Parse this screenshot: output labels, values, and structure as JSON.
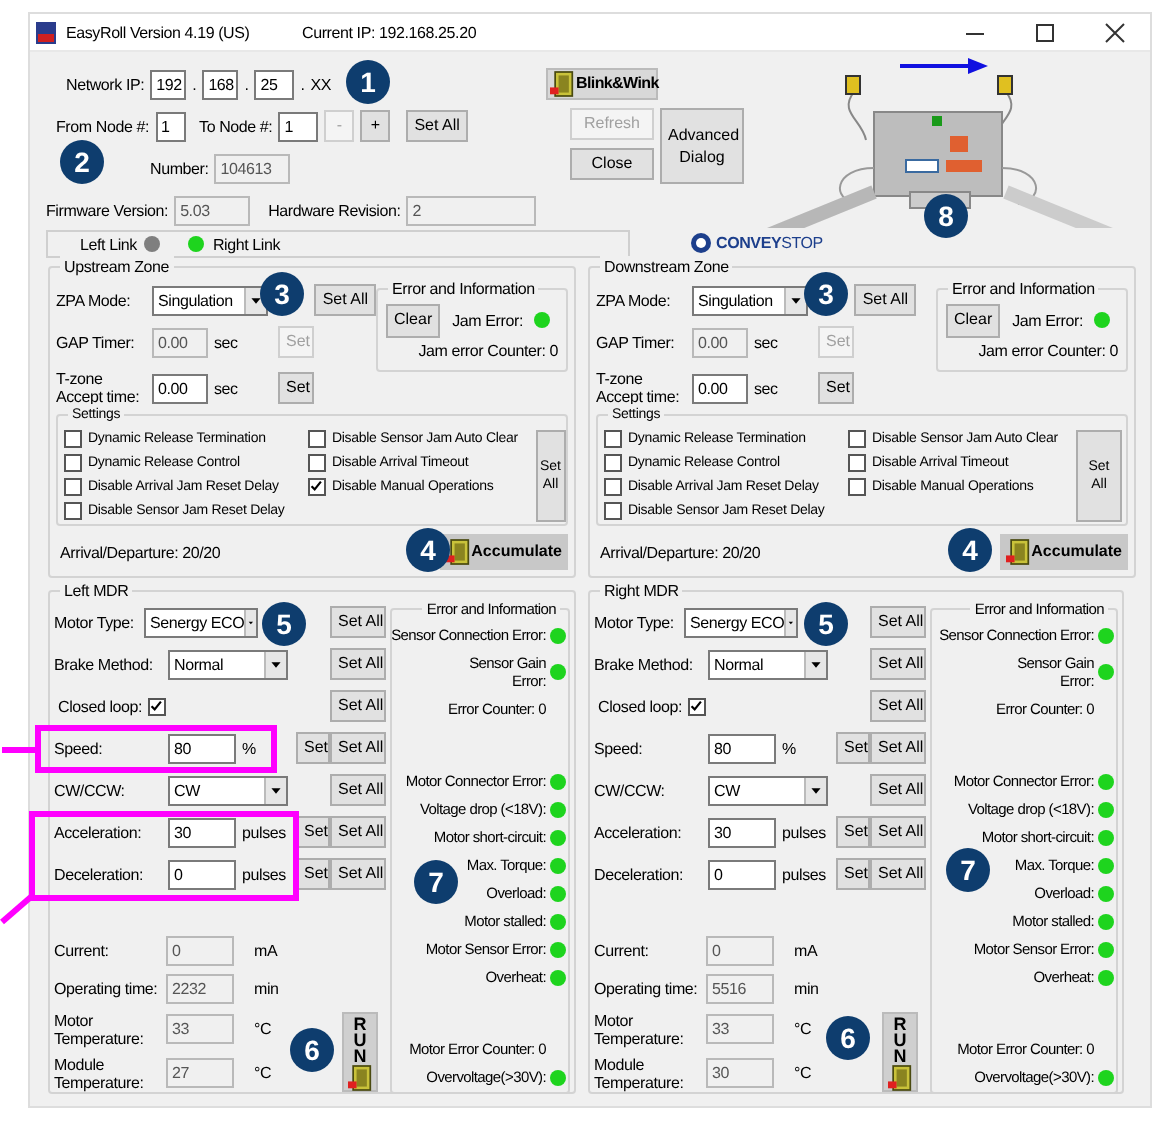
{
  "window": {
    "title": "EasyRoll Version 4.19 (US)",
    "current_ip": "Current IP: 192.168.25.20"
  },
  "header": {
    "network_ip": {
      "label": "Network IP:",
      "octets": [
        "192",
        "168",
        "25"
      ],
      "separators": [
        ".",
        ".",
        "."
      ],
      "suffix": "XX"
    },
    "from_node": {
      "label": "From Node #:",
      "value": "1"
    },
    "to_node": {
      "label": "To Node #:",
      "value": "1"
    },
    "node_buttons": [
      {
        "label": "-",
        "disabled": true
      },
      {
        "label": "+",
        "disabled": false
      },
      {
        "label": "Set All",
        "disabled": false
      }
    ],
    "serial": {
      "label": "Number:",
      "value": "104613"
    },
    "firmware": {
      "label": "Firmware Version:",
      "value": "5.03"
    },
    "hardware": {
      "label": "Hardware Revision:",
      "value": "2"
    },
    "links": [
      {
        "label": "Left Link",
        "color": "#7f7f7f"
      },
      {
        "label": "Right Link",
        "color": "#1ed41e"
      }
    ],
    "blink_button": "Blink&Wink",
    "refresh_button": {
      "label": "Refresh",
      "disabled": true
    },
    "close_button": {
      "label": "Close",
      "disabled": false
    },
    "advanced_button": "Advanced Dialog",
    "logo": "**CONVEY**STOP"
  },
  "zones": [
    {
      "title": "Upstream Zone",
      "zpa": {
        "label": "ZPA Mode:",
        "value": "Singulation",
        "button": "Set All"
      },
      "gap": {
        "label": "GAP Timer:",
        "value": "0.00",
        "unit": "sec",
        "button": "Set",
        "disabled": true
      },
      "tzone": {
        "label": "T-zone Accept time:",
        "value": "0.00",
        "unit": "sec",
        "button": "Set",
        "disabled": false
      },
      "error": {
        "title": "Error and Information",
        "clear": "Clear",
        "jam": {
          "label": "Jam Error:",
          "color": "#1ed41e"
        },
        "counter": "Jam error Counter: 0"
      },
      "settings": {
        "title": "Settings",
        "button": "Set All",
        "items": [
          {
            "label": "Dynamic Release Termination",
            "checked": false
          },
          {
            "label": "Disable Sensor Jam Auto Clear",
            "checked": false
          },
          {
            "label": "Dynamic Release Control",
            "checked": false
          },
          {
            "label": "Disable Arrival Timeout",
            "checked": false
          },
          {
            "label": "Disable Arrival Jam Reset Delay",
            "checked": false
          },
          {
            "label": "Disable Manual Operations",
            "checked": true
          },
          {
            "label": "Disable Sensor Jam Reset Delay",
            "checked": false
          }
        ]
      },
      "arrival": "Arrival/Departure: 20/20",
      "accumulate": "Accumulate"
    },
    {
      "title": "Downstream Zone",
      "zpa": {
        "label": "ZPA Mode:",
        "value": "Singulation",
        "button": "Set All"
      },
      "gap": {
        "label": "GAP Timer:",
        "value": "0.00",
        "unit": "sec",
        "button": "Set",
        "disabled": true
      },
      "tzone": {
        "label": "T-zone Accept time:",
        "value": "0.00",
        "unit": "sec",
        "button": "Set",
        "disabled": false
      },
      "error": {
        "title": "Error and Information",
        "clear": "Clear",
        "jam": {
          "label": "Jam Error:",
          "color": "#1ed41e"
        },
        "counter": "Jam error Counter: 0"
      },
      "settings": {
        "title": "Settings",
        "button": "Set All",
        "items": [
          {
            "label": "Dynamic Release Termination",
            "checked": false
          },
          {
            "label": "Disable Sensor Jam Auto Clear",
            "checked": false
          },
          {
            "label": "Dynamic Release Control",
            "checked": false
          },
          {
            "label": "Disable Arrival Timeout",
            "checked": false
          },
          {
            "label": "Disable Arrival Jam Reset Delay",
            "checked": false
          },
          {
            "label": "Disable Manual Operations",
            "checked": false
          },
          {
            "label": "Disable Sensor Jam Reset Delay",
            "checked": false
          }
        ]
      },
      "arrival": "Arrival/Departure: 20/20",
      "accumulate": "Accumulate"
    }
  ],
  "mdrs": [
    {
      "title": "Left MDR",
      "rows": [
        {
          "kind": "select",
          "label": "Motor Type:",
          "value": "Senergy ECO",
          "set_all": "Set All"
        },
        {
          "kind": "select",
          "label": "Brake Method:",
          "value": "Normal",
          "set_all": "Set All"
        },
        {
          "kind": "checkbox",
          "label": "Closed loop:",
          "checked": true,
          "set_all": "Set All"
        },
        {
          "kind": "input",
          "label": "Speed:",
          "value": "80",
          "unit": "%",
          "set": "Set",
          "set_all": "Set All"
        },
        {
          "kind": "select",
          "label": "CW/CCW:",
          "value": "CW",
          "set_all": "Set All"
        },
        {
          "kind": "input",
          "label": "Acceleration:",
          "value": "30",
          "unit": "pulses",
          "set": "Set",
          "set_all": "Set All"
        },
        {
          "kind": "input",
          "label": "Deceleration:",
          "value": "0",
          "unit": "pulses",
          "set": "Set",
          "set_all": "Set All"
        }
      ],
      "readouts": [
        {
          "label": "Current:",
          "value": "0",
          "unit": "mA"
        },
        {
          "label": "Operating time:",
          "value": "2232",
          "unit": "min"
        },
        {
          "label": "Motor Temperature:",
          "value": "33",
          "unit": "°C"
        },
        {
          "label": "Module Temperature:",
          "value": "27",
          "unit": "°C"
        }
      ],
      "run_button": "RUN",
      "errors": {
        "title": "Error and Information",
        "groups": [
          {
            "items": [
              {
                "kind": "indicator",
                "label": "Sensor Connection Error:",
                "color": "#1ed41e"
              },
              {
                "kind": "indicator",
                "label": "Sensor Gain Error:",
                "color": "#1ed41e"
              },
              {
                "kind": "counter",
                "label": "Error Counter: 0"
              }
            ]
          },
          {
            "items": [
              {
                "kind": "indicator",
                "label": "Motor Connector Error:",
                "color": "#1ed41e"
              },
              {
                "kind": "indicator",
                "label": "Voltage drop (<18V):",
                "color": "#1ed41e"
              },
              {
                "kind": "indicator",
                "label": "Motor short-circuit:",
                "color": "#1ed41e"
              },
              {
                "kind": "indicator",
                "label": "Max. Torque:",
                "color": "#1ed41e"
              },
              {
                "kind": "indicator",
                "label": "Overload:",
                "color": "#1ed41e"
              },
              {
                "kind": "indicator",
                "label": "Motor stalled:",
                "color": "#1ed41e"
              },
              {
                "kind": "indicator",
                "label": "Motor Sensor Error:",
                "color": "#1ed41e"
              },
              {
                "kind": "indicator",
                "label": "Overheat:",
                "color": "#1ed41e"
              }
            ]
          },
          {
            "items": [
              {
                "kind": "counter",
                "label": "Motor Error Counter: 0"
              },
              {
                "kind": "indicator",
                "label": "Overvoltage(>30V):",
                "color": "#1ed41e"
              }
            ]
          }
        ]
      }
    },
    {
      "title": "Right MDR",
      "rows": [
        {
          "kind": "select",
          "label": "Motor Type:",
          "value": "Senergy ECO",
          "set_all": "Set All"
        },
        {
          "kind": "select",
          "label": "Brake Method:",
          "value": "Normal",
          "set_all": "Set All"
        },
        {
          "kind": "checkbox",
          "label": "Closed loop:",
          "checked": true,
          "set_all": "Set All"
        },
        {
          "kind": "input",
          "label": "Speed:",
          "value": "80",
          "unit": "%",
          "set": "Set",
          "set_all": "Set All"
        },
        {
          "kind": "select",
          "label": "CW/CCW:",
          "value": "CW",
          "set_all": "Set All"
        },
        {
          "kind": "input",
          "label": "Acceleration:",
          "value": "30",
          "unit": "pulses",
          "set": "Set",
          "set_all": "Set All"
        },
        {
          "kind": "input",
          "label": "Deceleration:",
          "value": "0",
          "unit": "pulses",
          "set": "Set",
          "set_all": "Set All"
        }
      ],
      "readouts": [
        {
          "label": "Current:",
          "value": "0",
          "unit": "mA"
        },
        {
          "label": "Operating time:",
          "value": "5516",
          "unit": "min"
        },
        {
          "label": "Motor Temperature:",
          "value": "33",
          "unit": "°C"
        },
        {
          "label": "Module Temperature:",
          "value": "30",
          "unit": "°C"
        }
      ],
      "run_button": "RUN",
      "errors": {
        "title": "Error and Information",
        "groups": [
          {
            "items": [
              {
                "kind": "indicator",
                "label": "Sensor Connection Error:",
                "color": "#1ed41e"
              },
              {
                "kind": "indicator",
                "label": "Sensor Gain Error:",
                "color": "#1ed41e"
              },
              {
                "kind": "counter",
                "label": "Error Counter: 0"
              }
            ]
          },
          {
            "items": [
              {
                "kind": "indicator",
                "label": "Motor Connector Error:",
                "color": "#1ed41e"
              },
              {
                "kind": "indicator",
                "label": "Voltage drop (<18V):",
                "color": "#1ed41e"
              },
              {
                "kind": "indicator",
                "label": "Motor short-circuit:",
                "color": "#1ed41e"
              },
              {
                "kind": "indicator",
                "label": "Max. Torque:",
                "color": "#1ed41e"
              },
              {
                "kind": "indicator",
                "label": "Overload:",
                "color": "#1ed41e"
              },
              {
                "kind": "indicator",
                "label": "Motor stalled:",
                "color": "#1ed41e"
              },
              {
                "kind": "indicator",
                "label": "Motor Sensor Error:",
                "color": "#1ed41e"
              },
              {
                "kind": "indicator",
                "label": "Overheat:",
                "color": "#1ed41e"
              }
            ]
          },
          {
            "items": [
              {
                "kind": "counter",
                "label": "Motor Error Counter: 0"
              },
              {
                "kind": "indicator",
                "label": "Overvoltage(>30V):",
                "color": "#1ed41e"
              }
            ]
          }
        ]
      }
    }
  ],
  "callouts": [
    {
      "label": "1"
    },
    {
      "label": "2"
    },
    {
      "label": "3"
    },
    {
      "label": "3"
    },
    {
      "label": "4"
    },
    {
      "label": "4"
    },
    {
      "label": "5"
    },
    {
      "label": "5"
    },
    {
      "label": "6"
    },
    {
      "label": "6"
    },
    {
      "label": "7"
    },
    {
      "label": "7"
    },
    {
      "label": "8"
    }
  ]
}
